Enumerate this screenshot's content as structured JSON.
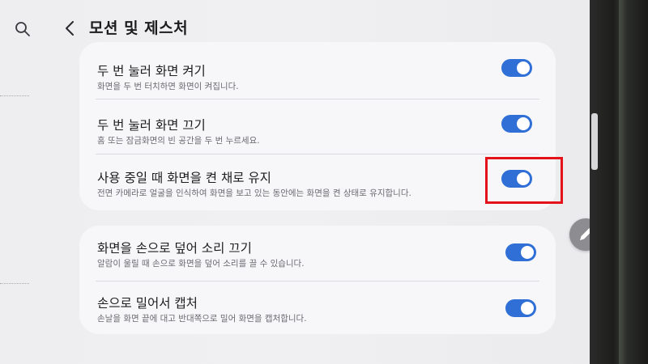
{
  "header": {
    "title": "모션 및 제스처",
    "back_icon": "chevron-left-icon",
    "search_icon": "search-icon"
  },
  "settings": [
    {
      "title": "두 번 눌러 화면 켜기",
      "subtitle": "화면을 두 번 터치하면 화면이 켜집니다.",
      "enabled": true
    },
    {
      "title": "두 번 눌러 화면 끄기",
      "subtitle": "홈 또는 잠금화면의 빈 공간을 두 번 누르세요.",
      "enabled": true
    },
    {
      "title": "사용 중일 때 화면을 켠 채로 유지",
      "subtitle": "전면 카메라로 얼굴을 인식하여 화면을 보고 있는 동안에는 화면을 켠 상태로 유지합니다.",
      "enabled": true
    },
    {
      "title": "화면을 손으로 덮어 소리 끄기",
      "subtitle": "알람이 울릴 때 손으로 화면을 덮어 소리를 끌 수 있습니다.",
      "enabled": true
    },
    {
      "title": "손으로 밀어서 캡처",
      "subtitle": "손날을 화면 끝에 대고 반대쪽으로 밀어 화면을 캡처합니다.",
      "enabled": true
    }
  ],
  "fab": {
    "icon": "pencil-icon"
  },
  "colors": {
    "accent": "#2f6fd6",
    "highlight": "#e3121b",
    "card_bg": "#f7f7f9",
    "page_bg": "#eeeef0"
  }
}
